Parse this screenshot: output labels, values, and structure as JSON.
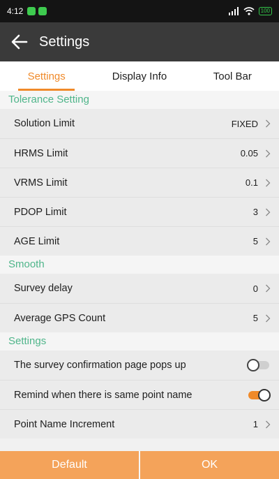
{
  "status_bar": {
    "time": "4:12",
    "battery": "100"
  },
  "app_bar": {
    "title": "Settings"
  },
  "tabs": [
    {
      "label": "Settings",
      "active": true
    },
    {
      "label": "Display Info",
      "active": false
    },
    {
      "label": "Tool Bar",
      "active": false
    }
  ],
  "sections": {
    "tolerance": {
      "title": "Tolerance Setting",
      "rows": [
        {
          "label": "Solution Limit",
          "value": "FIXED"
        },
        {
          "label": "HRMS Limit",
          "value": "0.05"
        },
        {
          "label": "VRMS Limit",
          "value": "0.1"
        },
        {
          "label": "PDOP Limit",
          "value": "3"
        },
        {
          "label": "AGE Limit",
          "value": "5"
        }
      ]
    },
    "smooth": {
      "title": "Smooth",
      "rows": [
        {
          "label": "Survey delay",
          "value": "0"
        },
        {
          "label": "Average GPS Count",
          "value": "5"
        }
      ]
    },
    "settings": {
      "title": "Settings",
      "rows": [
        {
          "label": "The survey confirmation page pops up",
          "toggle": false
        },
        {
          "label": "Remind when there is same point name",
          "toggle": true
        },
        {
          "label": "Point Name Increment",
          "value": "1"
        }
      ]
    }
  },
  "buttons": {
    "default_label": "Default",
    "ok_label": "OK"
  },
  "colors": {
    "accent": "#f08a2a",
    "section_header": "#4fb58a",
    "button": "#f4a35a",
    "app_bar": "#3a3a3a"
  }
}
